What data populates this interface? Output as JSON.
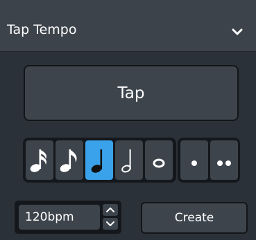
{
  "panel": {
    "title": "Tap Tempo",
    "collapse_icon": "chevron-down-icon"
  },
  "tap_button": {
    "label": "Tap"
  },
  "durations": {
    "items": [
      {
        "icon": "sixteenth-note-icon",
        "selected": false
      },
      {
        "icon": "eighth-note-icon",
        "selected": false
      },
      {
        "icon": "quarter-note-icon",
        "selected": true
      },
      {
        "icon": "half-note-icon",
        "selected": false
      },
      {
        "icon": "whole-note-icon",
        "selected": false
      }
    ],
    "dots": [
      {
        "icon": "single-dot-icon",
        "selected": false
      },
      {
        "icon": "double-dot-icon",
        "selected": false
      }
    ]
  },
  "tempo": {
    "value": "120bpm",
    "increment_icon": "chevron-up-icon",
    "decrement_icon": "chevron-down-icon"
  },
  "create_button": {
    "label": "Create"
  },
  "colors": {
    "background": "#2b3138",
    "header": "#3c434b",
    "button": "#3d444c",
    "selected": "#3aa2ea",
    "outline": "#14181c"
  }
}
